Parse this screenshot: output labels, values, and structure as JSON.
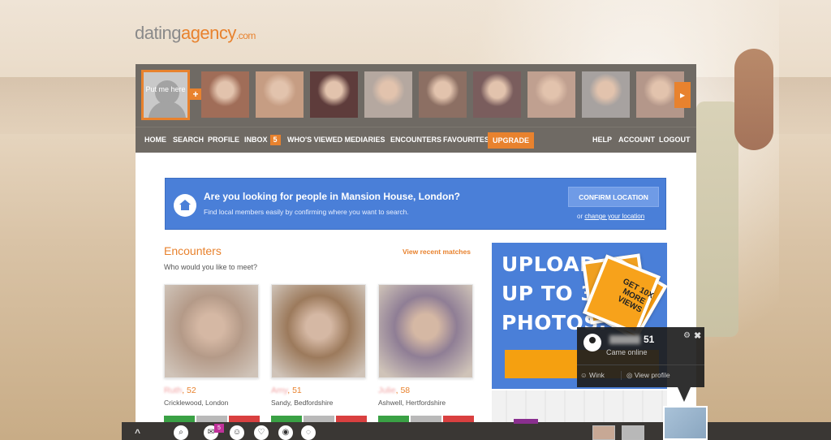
{
  "logo": {
    "part1": "dating",
    "part2": "agency",
    "part3": ".com"
  },
  "strip": {
    "put_me_here": "Put me here",
    "plus": "+",
    "next": "▸",
    "thumb_colors": [
      "#a06d58",
      "#c69d83",
      "#5e3c3b",
      "#b5a8a0",
      "#8c6f63",
      "#7a5d5d",
      "#c0a090",
      "#a7a2a0",
      "#b4978a"
    ]
  },
  "nav": {
    "home": "HOME",
    "search": "SEARCH",
    "profile": "PROFILE",
    "inbox": "INBOX",
    "inbox_count": "5",
    "whos_viewed": "WHO'S VIEWED ME",
    "diaries": "DIARIES",
    "encounters": "ENCOUNTERS",
    "favourites": "FAVOURITES",
    "upgrade": "UPGRADE",
    "help": "HELP",
    "account": "ACCOUNT",
    "logout": "LOGOUT"
  },
  "location": {
    "title": "Are you looking for people in Mansion House, London?",
    "subtitle": "Find local members easily by confirming where you want to search.",
    "button": "CONFIRM LOCATION",
    "or_text": "or ",
    "change_link": "change your location"
  },
  "encounters": {
    "title": "Encounters",
    "subtitle": "Who would you like to meet?",
    "recent_link": "View recent matches",
    "cards": [
      {
        "name": "Ruth",
        "age": ", 52",
        "location": "Cricklewood, London",
        "photo": "#b49a88"
      },
      {
        "name": "Amy",
        "age": ", 51",
        "location": "Sandy, Bedfordshire",
        "photo": "#9c7a5c"
      },
      {
        "name": "Julie",
        "age": ", 58",
        "location": "Ashwell, Hertfordshire",
        "photo": "#8f7e95"
      }
    ]
  },
  "promo": {
    "line1": "UPLOAD",
    "line2": "UP TO 30",
    "line3": "PHOTOS.",
    "tag": "GET 10X MORE VIEWS"
  },
  "notification": {
    "age": "51",
    "status": "Came online",
    "wink": "Wink",
    "view_profile": "View profile",
    "gear": "⚙",
    "close": "✖"
  },
  "toolbar": {
    "logo": "^",
    "message_count": "5"
  },
  "colors": {
    "accent": "#e8822e",
    "blue": "#4a7fd8",
    "dark": "#6f6a64"
  }
}
